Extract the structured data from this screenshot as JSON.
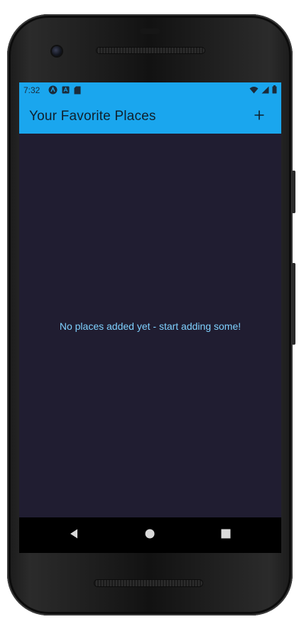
{
  "status_bar": {
    "time": "7:32",
    "left_icons": [
      "android-studio-icon",
      "a-box-icon",
      "sd-card-icon"
    ],
    "right_icons": [
      "wifi-icon",
      "cell-signal-icon",
      "battery-icon"
    ]
  },
  "app_bar": {
    "title": "Your Favorite Places",
    "action_icon": "plus-icon",
    "background_color": "#1aa6ee"
  },
  "content": {
    "empty_message": "No places added yet - start adding some!",
    "background_color": "#201d31",
    "message_color": "#7fd1ff"
  },
  "navigation": {
    "buttons": [
      "back-icon",
      "home-icon",
      "recents-icon"
    ]
  }
}
